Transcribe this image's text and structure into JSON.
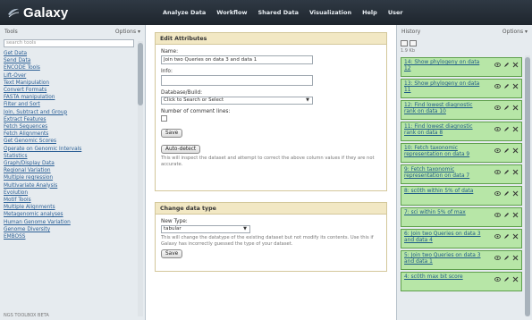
{
  "masthead": {
    "brand": "Galaxy",
    "nav": [
      "Analyze Data",
      "Workflow",
      "Shared Data",
      "Visualization",
      "Help",
      "User"
    ]
  },
  "tools": {
    "title": "Tools",
    "options": "Options",
    "search_placeholder": "search tools",
    "items": [
      "Get Data",
      "Send Data",
      "ENCODE Tools",
      "Lift-Over",
      "Text Manipulation",
      "Convert Formats",
      "FASTA manipulation",
      "Filter and Sort",
      "Join, Subtract and Group",
      "Extract Features",
      "Fetch Sequences",
      "Fetch Alignments",
      "Get Genomic Scores",
      "Operate on Genomic Intervals",
      "Statistics",
      "Graph/Display Data",
      "Regional Variation",
      "Multiple regression",
      "Multivariate Analysis",
      "Evolution",
      "Motif Tools",
      "Multiple Alignments",
      "Metagenomic analyses",
      "Human Genome Variation",
      "Genome Diversity",
      "EMBOSS"
    ],
    "footer": "NGS TOOLBOX BETA"
  },
  "edit_attributes": {
    "title": "Edit Attributes",
    "name_label": "Name:",
    "name_value": "Join two Queries on data 3 and data 1",
    "info_label": "Info:",
    "database_label": "Database/Build:",
    "database_value": "Click to Search or Select",
    "comment_lines_label": "Number of comment lines:",
    "save_label": "Save",
    "auto_detect_label": "Auto-detect",
    "auto_detect_help": "This will inspect the dataset and attempt to correct the above column values if they are not accurate."
  },
  "change_type": {
    "title": "Change data type",
    "new_type_label": "New Type:",
    "new_type_value": "tabular",
    "help": "This will change the datatype of the existing dataset but not modify its contents. Use this if Galaxy has incorrectly guessed the type of your dataset.",
    "save_label": "Save"
  },
  "history": {
    "title": "History",
    "options": "Options",
    "size": "1.9 Kb",
    "datasets": [
      "14: Show phylogeny on data 12",
      "13: Show phylogeny on data 11",
      "12: Find lowest diagnostic rank on data 10",
      "11: Find lowest diagnostic rank on data 8",
      "10: Fetch taxonomic representation on data 9",
      "9: Fetch taxonomic representation on data 7",
      "8: sc0th within 5% of data",
      "7: sci within 5% of max",
      "6: Join two Queries on data 3 and data 4",
      "5: Join two Queries on data 3 and data 1",
      "4: sc0th max bit score"
    ]
  },
  "colors": {
    "masthead": "#2f3944",
    "panel_bg": "#e6ebef",
    "dataset_ok": "#b7e6a7",
    "link": "#2b5f95",
    "form_title_bg": "#f2e8c4"
  }
}
